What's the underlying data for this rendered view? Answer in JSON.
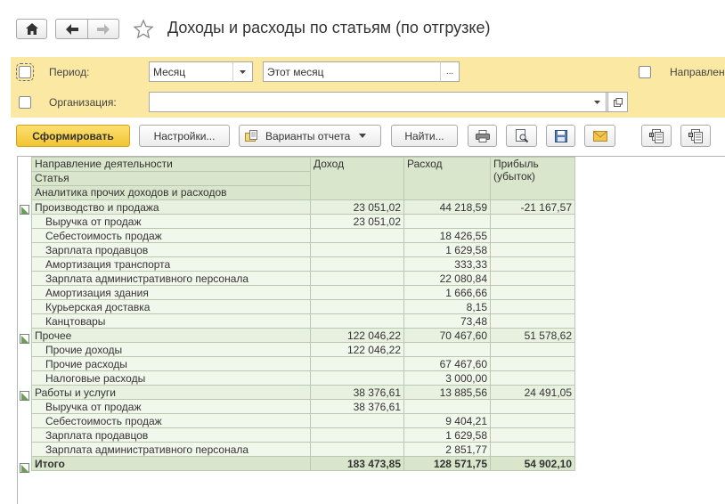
{
  "window": {
    "title": "Доходы и расходы по статьям (по отгрузке)"
  },
  "filters": {
    "period_label": "Период:",
    "period_value": "Месяц",
    "period_range": "Этот месяц",
    "period_range_btn": "...",
    "organization_label": "Организация:",
    "organization_value": "",
    "direction_label": "Направлен"
  },
  "toolbar": {
    "generate": "Сформировать",
    "settings": "Настройки...",
    "variants": "Варианты отчета",
    "find": "Найти..."
  },
  "report": {
    "headers": {
      "direction": "Направление деятельности",
      "article": "Статья",
      "analytics": "Аналитика прочих доходов и расходов",
      "income": "Доход",
      "expense": "Расход",
      "profit_line1": "Прибыль",
      "profit_line2": "(убыток)"
    },
    "rows": [
      {
        "level": 0,
        "name": "Производство и продажа",
        "income": "23 051,02",
        "expense": "44 218,59",
        "profit": "-21 167,57"
      },
      {
        "level": 1,
        "name": "Выручка от продаж",
        "income": "23 051,02",
        "expense": "",
        "profit": ""
      },
      {
        "level": 1,
        "name": "Себестоимость продаж",
        "income": "",
        "expense": "18 426,55",
        "profit": ""
      },
      {
        "level": 1,
        "name": "Зарплата продавцов",
        "income": "",
        "expense": "1 629,58",
        "profit": ""
      },
      {
        "level": 1,
        "name": "Амортизация транспорта",
        "income": "",
        "expense": "333,33",
        "profit": ""
      },
      {
        "level": 1,
        "name": "Зарплата административного персонала",
        "income": "",
        "expense": "22 080,84",
        "profit": ""
      },
      {
        "level": 1,
        "name": "Амортизация здания",
        "income": "",
        "expense": "1 666,66",
        "profit": ""
      },
      {
        "level": 1,
        "name": "Курьерская доставка",
        "income": "",
        "expense": "8,15",
        "profit": ""
      },
      {
        "level": 1,
        "name": "Канцтовары",
        "income": "",
        "expense": "73,48",
        "profit": ""
      },
      {
        "level": 0,
        "name": "Прочее",
        "income": "122 046,22",
        "expense": "70 467,60",
        "profit": "51 578,62"
      },
      {
        "level": 1,
        "name": "Прочие доходы",
        "income": "122 046,22",
        "expense": "",
        "profit": ""
      },
      {
        "level": 1,
        "name": "Прочие расходы",
        "income": "",
        "expense": "67 467,60",
        "profit": ""
      },
      {
        "level": 1,
        "name": "Налоговые расходы",
        "income": "",
        "expense": "3 000,00",
        "profit": ""
      },
      {
        "level": 0,
        "name": "Работы и услуги",
        "income": "38 376,61",
        "expense": "13 885,56",
        "profit": "24 491,05"
      },
      {
        "level": 1,
        "name": "Выручка от продаж",
        "income": "38 376,61",
        "expense": "",
        "profit": ""
      },
      {
        "level": 1,
        "name": "Себестоимость продаж",
        "income": "",
        "expense": "9 404,21",
        "profit": ""
      },
      {
        "level": 1,
        "name": "Зарплата продавцов",
        "income": "",
        "expense": "1 629,58",
        "profit": ""
      },
      {
        "level": 1,
        "name": "Зарплата административного персонала",
        "income": "",
        "expense": "2 851,77",
        "profit": ""
      }
    ],
    "total": {
      "name": "Итого",
      "income": "183 473,85",
      "expense": "128 571,75",
      "profit": "54 902,10"
    }
  }
}
